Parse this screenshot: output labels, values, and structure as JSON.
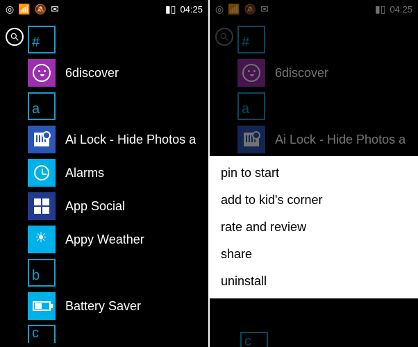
{
  "status": {
    "nfc": "◎",
    "wifi": "📶",
    "silent": "🔕",
    "msg": "✉",
    "battery": "▮▯",
    "time": "04:25"
  },
  "sections": {
    "hash": "#",
    "a": "a",
    "b": "b",
    "c": "c"
  },
  "apps": {
    "discover": "6discover",
    "ailock": "Ai Lock - Hide Photos a",
    "alarms": "Alarms",
    "appsocial": "App Social",
    "appyweather": "Appy Weather",
    "batterysaver": "Battery Saver"
  },
  "menu": {
    "pin": "pin to start",
    "kids": "add to kid's corner",
    "rate": "rate and review",
    "share": "share",
    "uninstall": "uninstall"
  }
}
